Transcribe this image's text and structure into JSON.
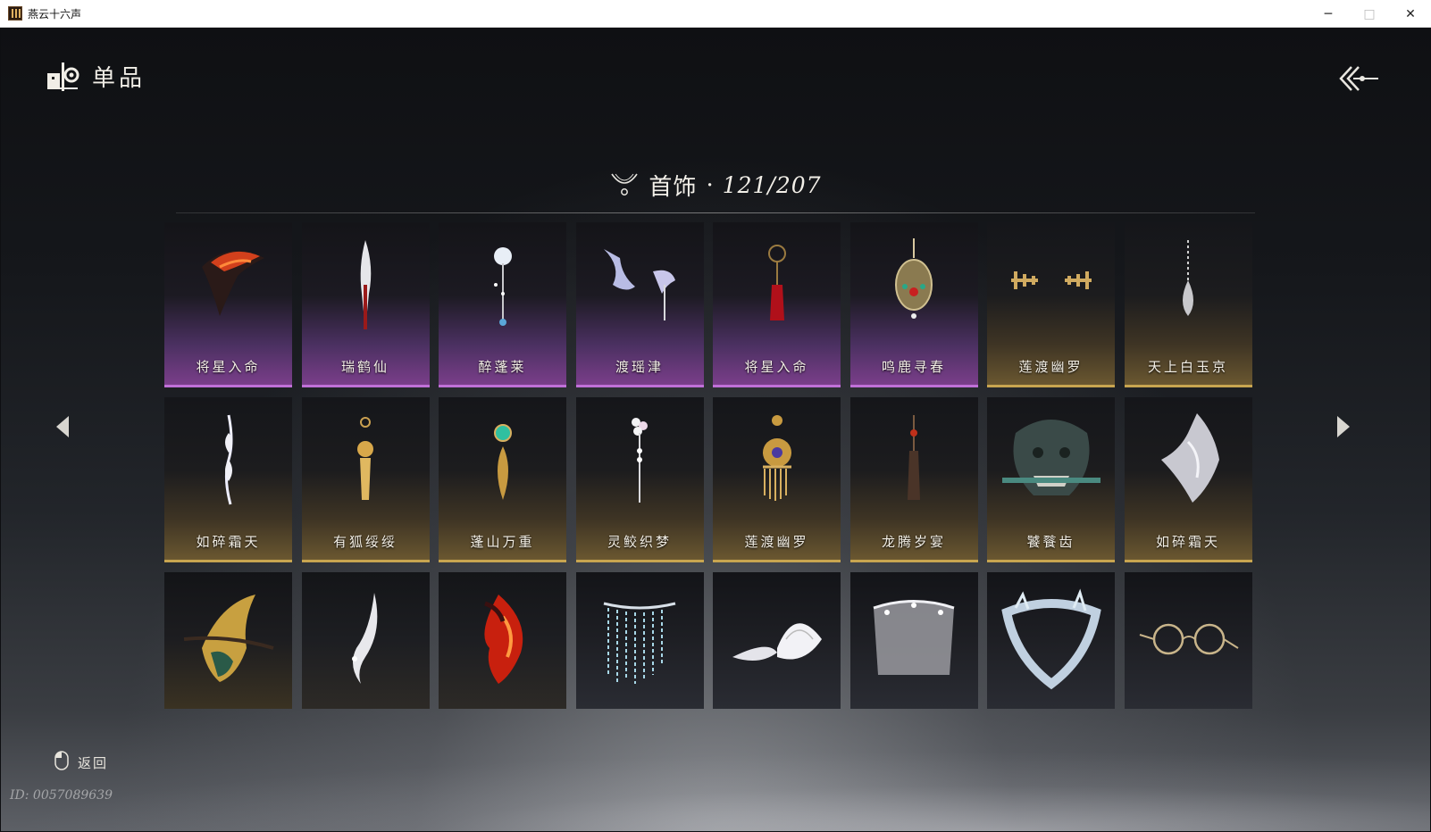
{
  "window": {
    "title": "燕云十六声",
    "minimize_label": "─",
    "maximize_label": "□",
    "close_label": "✕"
  },
  "header": {
    "title": "单品"
  },
  "section": {
    "title": "首饰",
    "separator": "·",
    "count": "121/207"
  },
  "items": [
    {
      "name": "将星入命",
      "icon": "flame-wing-ornament",
      "rarity": "purple"
    },
    {
      "name": "瑞鹤仙",
      "icon": "feather-hairpin",
      "rarity": "purple"
    },
    {
      "name": "醉蓬莱",
      "icon": "flower-hairpin",
      "rarity": "purple"
    },
    {
      "name": "渡瑶津",
      "icon": "twin-feather-clips",
      "rarity": "purple"
    },
    {
      "name": "将星入命",
      "icon": "red-tassel-pendant",
      "rarity": "purple"
    },
    {
      "name": "鸣鹿寻春",
      "icon": "jeweled-medallion",
      "rarity": "purple"
    },
    {
      "name": "莲渡幽罗",
      "icon": "gold-ear-cuffs",
      "rarity": "gold"
    },
    {
      "name": "天上白玉京",
      "icon": "pearl-drop-earring",
      "rarity": "gold"
    },
    {
      "name": "如碎霜天",
      "icon": "silver-leaf-earring",
      "rarity": "gold"
    },
    {
      "name": "有狐绥绥",
      "icon": "gold-tassel-earring",
      "rarity": "gold"
    },
    {
      "name": "蓬山万重",
      "icon": "jade-gold-earring",
      "rarity": "gold"
    },
    {
      "name": "灵鲛织梦",
      "icon": "pearl-flower-pin",
      "rarity": "gold"
    },
    {
      "name": "莲渡幽罗",
      "icon": "gold-fringe-pendant",
      "rarity": "gold"
    },
    {
      "name": "龙腾岁宴",
      "icon": "dark-tassel-pin",
      "rarity": "gold"
    },
    {
      "name": "饕餮齿",
      "icon": "beast-mask",
      "rarity": "gold"
    },
    {
      "name": "如碎霜天",
      "icon": "silver-flame-ornament",
      "rarity": "gold"
    },
    {
      "name": "",
      "icon": "jade-gold-crest",
      "rarity": "darkgold"
    },
    {
      "name": "",
      "icon": "white-blade-ornament",
      "rarity": "dark"
    },
    {
      "name": "",
      "icon": "red-flame-ornament",
      "rarity": "dark"
    },
    {
      "name": "",
      "icon": "crystal-veil",
      "rarity": "darkslate"
    },
    {
      "name": "",
      "icon": "white-wings",
      "rarity": "darkslate"
    },
    {
      "name": "",
      "icon": "pearl-veil",
      "rarity": "darkslate"
    },
    {
      "name": "",
      "icon": "ice-circlet",
      "rarity": "darkslate"
    },
    {
      "name": "",
      "icon": "round-glasses",
      "rarity": "darkslate"
    }
  ],
  "footer": {
    "return_label": "返回",
    "user_id": "ID: 0057089639"
  },
  "colors": {
    "purple_accent": "#c070d8",
    "gold_accent": "#c8a550"
  }
}
